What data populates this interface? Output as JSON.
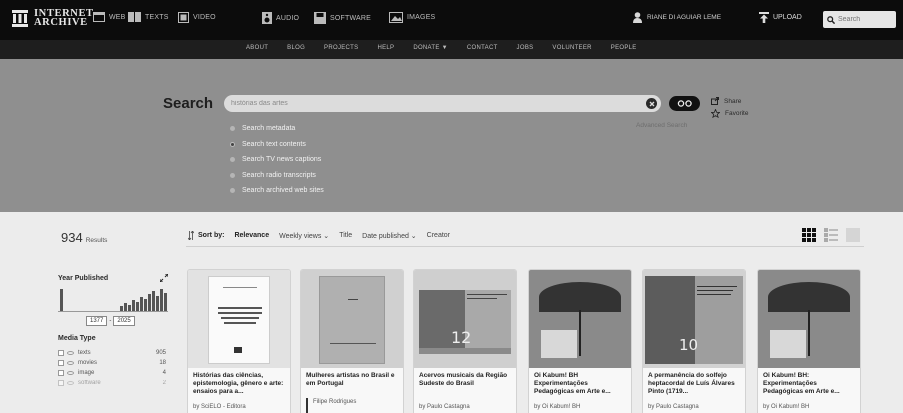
{
  "topbar": {
    "logo_line1": "INTERNET",
    "logo_line2": "ARCHIVE",
    "media": [
      {
        "label": "WEB",
        "icon": "web-icon"
      },
      {
        "label": "TEXTS",
        "icon": "book-icon"
      },
      {
        "label": "VIDEO",
        "icon": "film-icon"
      },
      {
        "label": "AUDIO",
        "icon": "speaker-icon"
      },
      {
        "label": "SOFTWARE",
        "icon": "floppy-icon"
      },
      {
        "label": "IMAGES",
        "icon": "image-icon"
      }
    ],
    "user": "RIANE DI AGUIAR LEME",
    "upload": "UPLOAD",
    "search_placeholder": "Search"
  },
  "nav": [
    "ABOUT",
    "BLOG",
    "PROJECTS",
    "HELP",
    "DONATE ▼",
    "CONTACT",
    "JOBS",
    "VOLUNTEER",
    "PEOPLE"
  ],
  "search": {
    "label": "Search",
    "value": "histórias das artes",
    "go": "GO",
    "advanced": "Advanced Search",
    "share": "Share",
    "favorite": "Favorite",
    "options": [
      {
        "label": "Search metadata",
        "selected": false
      },
      {
        "label": "Search text contents",
        "selected": true
      },
      {
        "label": "Search TV news captions",
        "selected": false
      },
      {
        "label": "Search radio transcripts",
        "selected": false
      },
      {
        "label": "Search archived web sites",
        "selected": false
      }
    ]
  },
  "results": {
    "count": "934",
    "count_label": "Results",
    "sort_by": "Sort by:",
    "sort_options": [
      "Relevance",
      "Weekly views ⌄",
      "Title",
      "Date published ⌄",
      "Creator"
    ]
  },
  "facets": {
    "year_heading": "Year Published",
    "year_from": "1377",
    "year_to": "2025",
    "media_heading": "Media Type",
    "media_types": [
      {
        "name": "texts",
        "count": "905"
      },
      {
        "name": "movies",
        "count": "18"
      },
      {
        "name": "image",
        "count": "4"
      },
      {
        "name": "software",
        "count": "2"
      }
    ]
  },
  "cards": [
    {
      "title": "Histórias das ciências, epistemologia, gênero e arte: ensaios para a...",
      "author": "by SciELO - Editora"
    },
    {
      "title": "Mulheres artistas no Brasil e em Portugal",
      "author": "Filipe Rodrigues"
    },
    {
      "title": "Acervos musicais da Região Sudeste do Brasil",
      "author": "by Paulo Castagna",
      "cover_number": "12"
    },
    {
      "title": "Oi Kabum! BH Experimentações Pedagógicas em Arte e...",
      "author": "by Oi Kabum! BH"
    },
    {
      "title": "A permanência do solfejo heptacordal de Luís Álvares Pinto (1719...",
      "author": "by Paulo Castagna",
      "cover_number": "10"
    },
    {
      "title": "Oi Kabum! BH: Experimentações Pedagógicas em Arte e...",
      "author": "by Oi Kabum! BH"
    }
  ]
}
